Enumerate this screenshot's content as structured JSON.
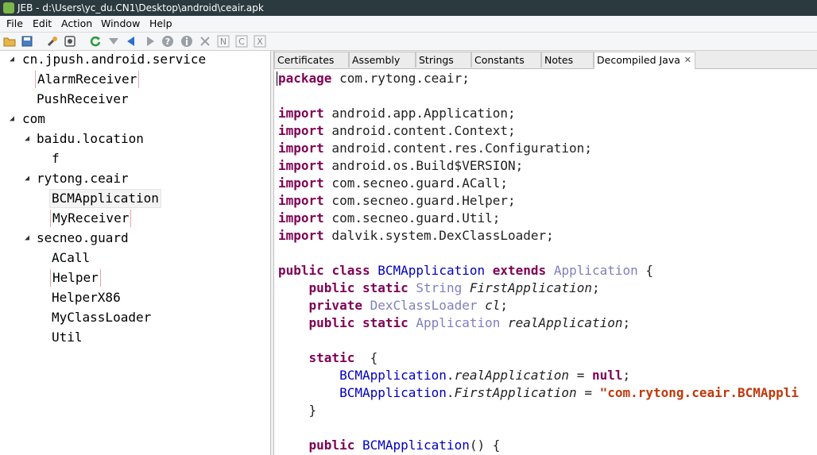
{
  "window": {
    "title": "JEB - d:\\Users\\yc_du.CN1\\Desktop\\android\\ceair.apk"
  },
  "menu": [
    "File",
    "Edit",
    "Action",
    "Window",
    "Help"
  ],
  "toolbar": {
    "icons": [
      "open-folder-icon",
      "save-icon",
      "wrench-icon",
      "settings-icon",
      "refresh-icon",
      "filter-icon",
      "back-icon",
      "forward-icon",
      "help-icon",
      "info-icon",
      "cross-icon",
      "n-icon",
      "c-icon",
      "x-icon"
    ]
  },
  "tree": {
    "pkg_jpush": "cn.jpush.android.service",
    "alarm_receiver": "AlarmReceiver",
    "push_receiver": "PushReceiver",
    "pkg_com": "com",
    "pkg_baidu": "baidu.location",
    "f": "f",
    "pkg_rytong": "rytong.ceair",
    "bcm_application": "BCMApplication",
    "my_receiver": "MyReceiver",
    "pkg_secneo": "secneo.guard",
    "acall": "ACall",
    "helper": "Helper",
    "helper_x86": "HelperX86",
    "my_class_loader": "MyClassLoader",
    "util": "Util"
  },
  "tabs": {
    "certificates": "Certificates",
    "assembly": "Assembly",
    "strings": "Strings",
    "constants": "Constants",
    "notes": "Notes",
    "decompiled_java": "Decompiled Java"
  },
  "code": {
    "kw_package": "package",
    "package_name": " com.rytong.ceair;",
    "kw_import": "import",
    "imports": [
      " android.app.Application;",
      " android.content.Context;",
      " android.content.res.Configuration;",
      " android.os.Build$VERSION;",
      " com.secneo.guard.ACall;",
      " com.secneo.guard.Helper;",
      " com.secneo.guard.Util;",
      " dalvik.system.DexClassLoader;"
    ],
    "kw_public": "public",
    "kw_class": "class",
    "kw_extends": "extends",
    "kw_static": "static",
    "kw_private": "private",
    "kw_null": "null",
    "class_name": "BCMApplication",
    "super_class": "Application",
    "open_brace": " {",
    "close_brace": "}",
    "semicolon": ";",
    "type_string": "String",
    "type_dex": "DexClassLoader",
    "type_app": "Application",
    "field_first": "FirstApplication",
    "field_cl": "cl",
    "field_real": "realApplication",
    "dot": ".",
    "assign": " = ",
    "string_literal": "\"com.rytong.ceair.BCMAppli",
    "ctor": "BCMApplication",
    "ctor_tail": "() {"
  }
}
